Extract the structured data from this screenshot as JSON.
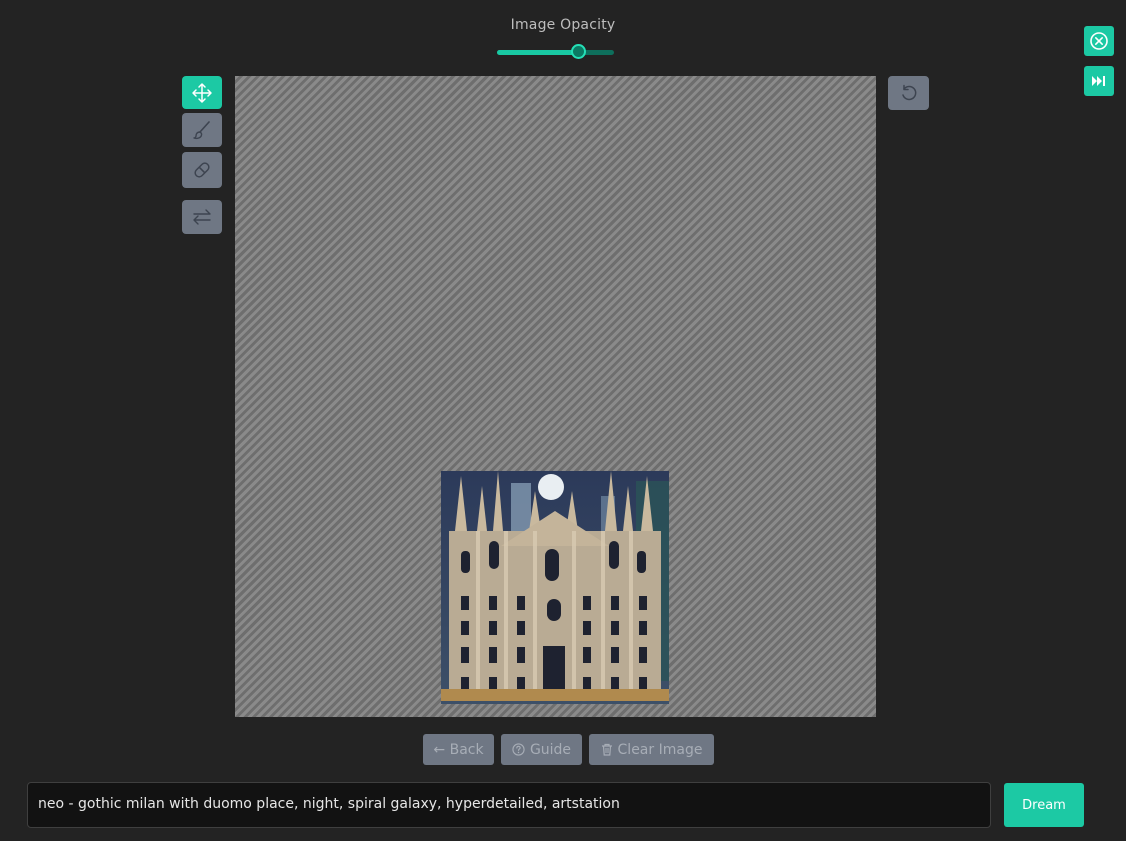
{
  "opacity": {
    "label": "Image Opacity",
    "value": 0.7
  },
  "tools": {
    "move": "move-arrows-icon",
    "brush": "paint-brush-icon",
    "eraser": "eraser-icon",
    "swap": "swap-arrows-icon",
    "reset": "rotate-ccw-icon"
  },
  "corner": {
    "close": "close-circle-icon",
    "skip": "fast-forward-icon"
  },
  "canvas": {
    "image_alt": "Gothic Milan duomo facade at night"
  },
  "actions": {
    "back_label": "← Back",
    "guide_label": "Guide",
    "clear_label": "Clear Image"
  },
  "prompt": {
    "value": "neo - gothic milan with duomo place, night, spiral galaxy, hyperdetailed, artstation"
  },
  "dream": {
    "label": "Dream"
  },
  "colors": {
    "accent": "#1cc9a4",
    "background": "#232323",
    "muted_button": "#6f7784"
  }
}
